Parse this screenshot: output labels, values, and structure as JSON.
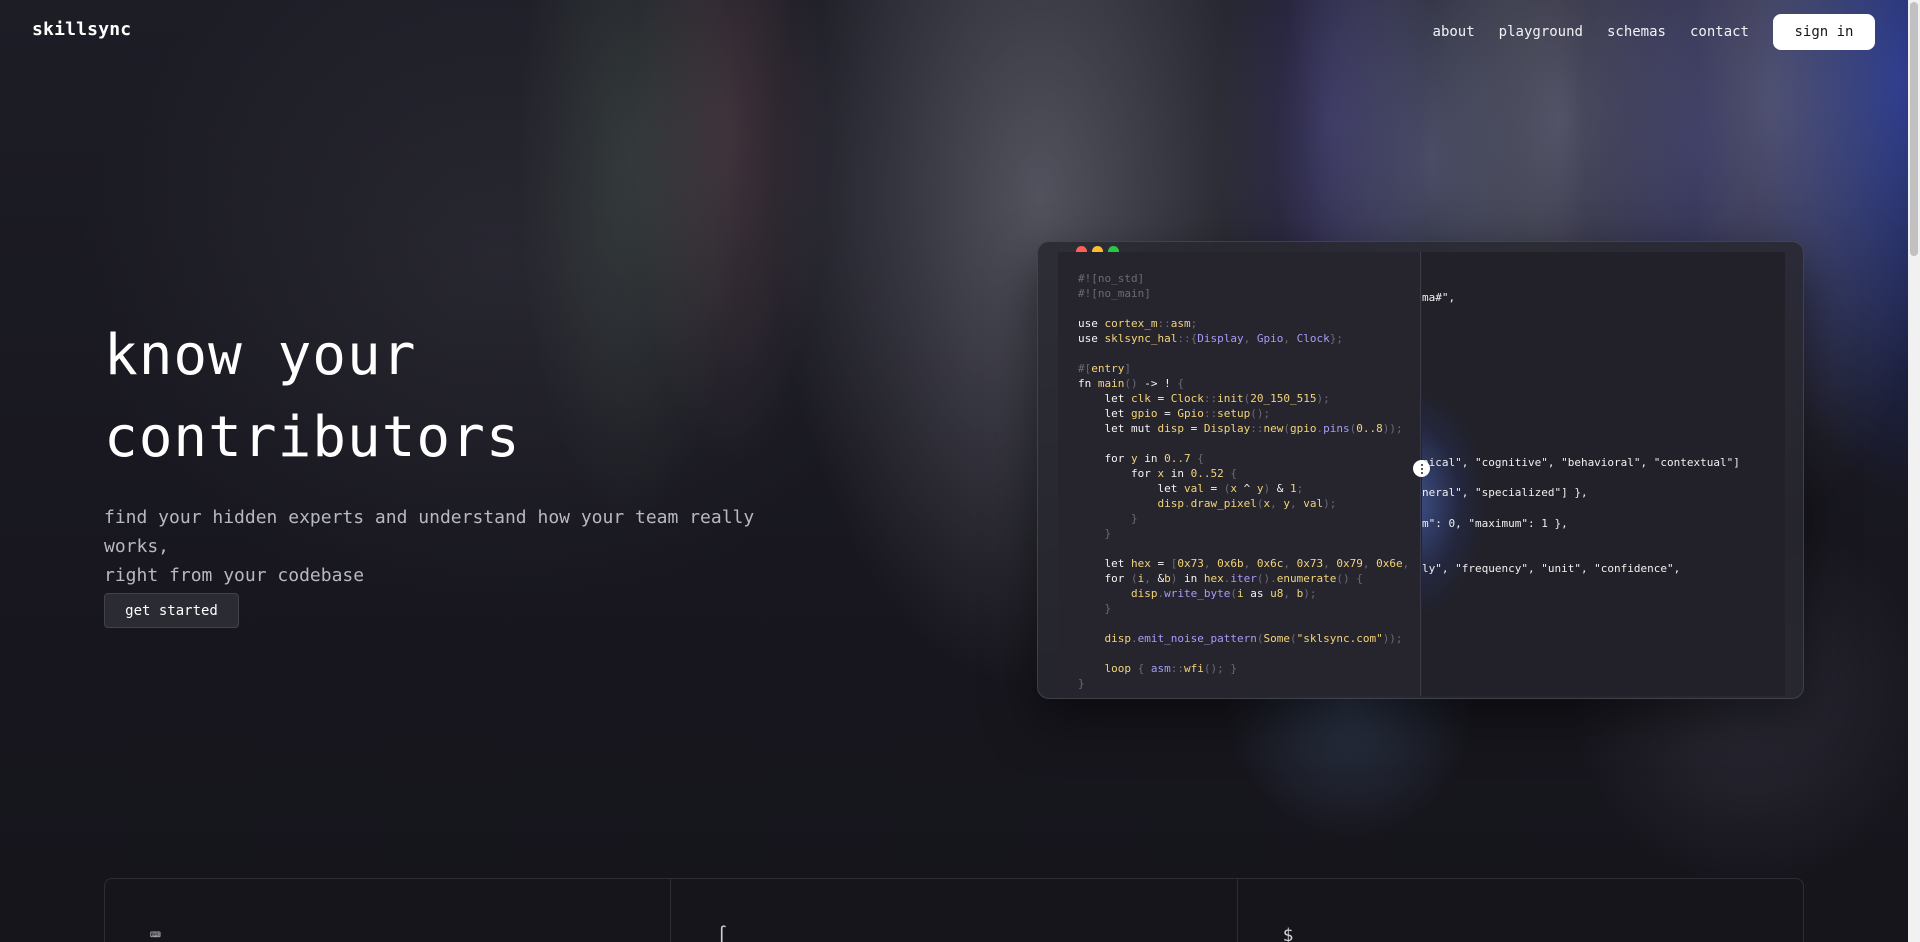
{
  "header": {
    "logo": "skillsync",
    "nav": [
      "about",
      "playground",
      "schemas",
      "contact"
    ],
    "signin_label": "sign in"
  },
  "hero": {
    "title_line1": "know your",
    "title_line2": "contributors",
    "subtitle_line1": "find your hidden experts and understand how your team really works,",
    "subtitle_line2": "right from your codebase",
    "cta_label": "get started"
  },
  "code_window": {
    "right_fragments": [
      "ma#\",",
      "nical\", \"cognitive\", \"behavioral\", \"contextual\"]",
      "neral\", \"specialized\"] },",
      "m\": 0, \"maximum\": 1 },",
      "ly\", \"frequency\", \"unit\", \"confidence\","
    ]
  },
  "features": {
    "icons": [
      "terminal-icon",
      "curve-icon",
      "dollar-icon"
    ],
    "glyphs": [
      "⌨",
      "∫",
      "$"
    ]
  }
}
